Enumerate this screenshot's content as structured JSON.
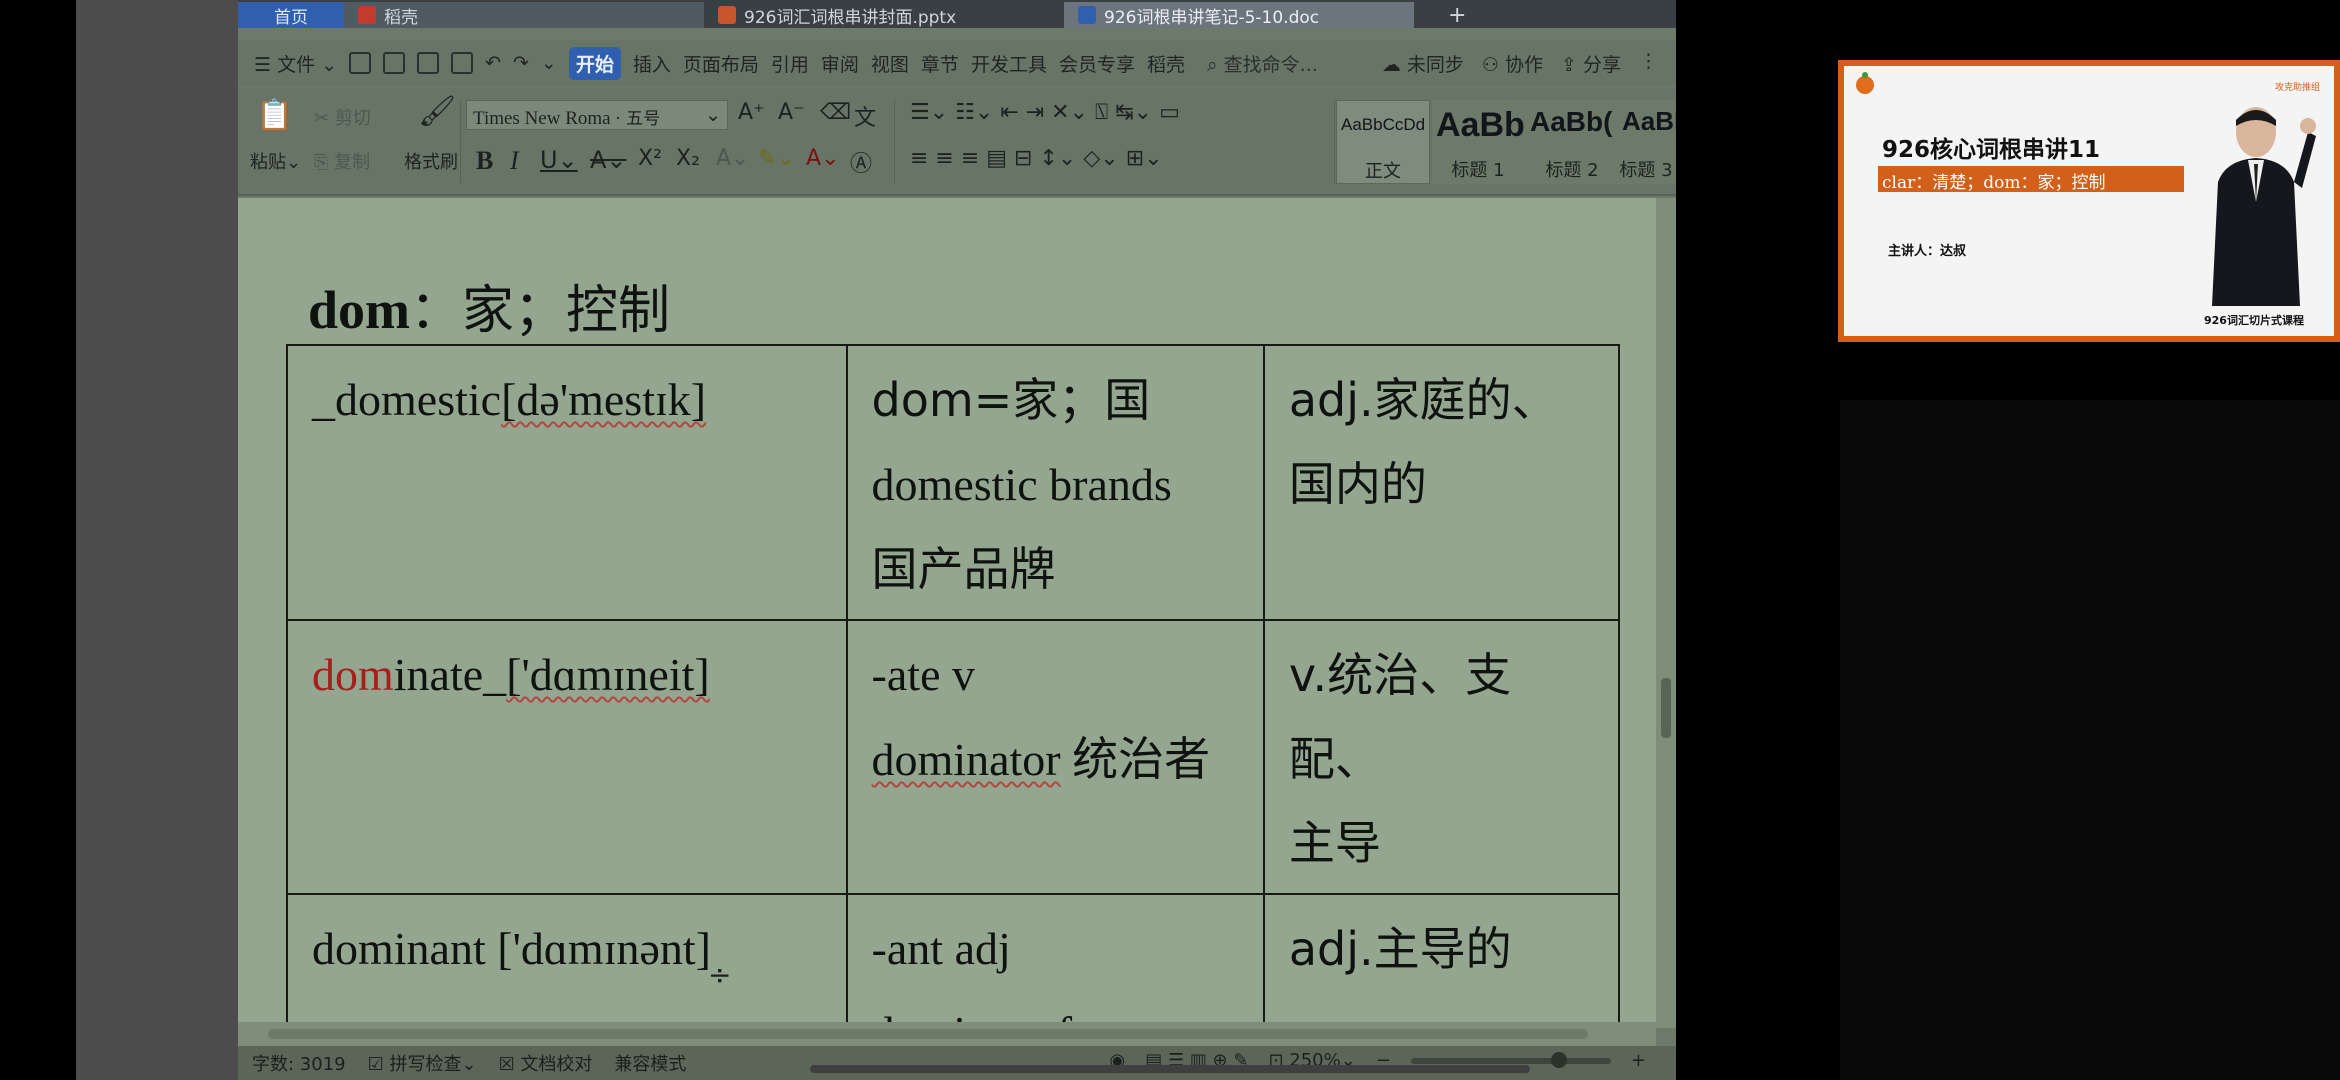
{
  "tabs": {
    "home": "首页",
    "daoke": "稻壳",
    "ppt": "926词汇词根串讲封面.pptx",
    "doc": "926词根串讲笔记-5-10.doc"
  },
  "menu": {
    "file": "文件",
    "start": "开始",
    "insert": "插入",
    "layout": "页面布局",
    "reference": "引用",
    "review": "审阅",
    "view": "视图",
    "chapter": "章节",
    "devtools": "开发工具",
    "vip": "会员专享",
    "daoke": "稻壳",
    "search_placeholder": "查找命令...",
    "unsynced": "未同步",
    "collab": "协作",
    "share": "分享"
  },
  "ribbon": {
    "paste": "粘贴",
    "cut": "剪切",
    "copy": "复制",
    "format_painter": "格式刷",
    "font_name": "Times New Roma",
    "font_size": "五号",
    "styles": [
      {
        "preview": "AaBbCcDd",
        "label": "正文"
      },
      {
        "preview": "AaBb",
        "label": "标题 1"
      },
      {
        "preview": "AaBb(",
        "label": "标题 2"
      },
      {
        "preview": "AaBbC",
        "label": "标题 3"
      }
    ]
  },
  "document": {
    "heading_en": "dom",
    "heading_cn": "：家；控制",
    "rows": [
      {
        "word_prefix": "",
        "word": "_domestic",
        "phonetic": "[də'mestɪk]",
        "root_line1": "dom=家；国",
        "root_line2": "domestic brands",
        "root_line3": "国产品牌",
        "meaning_line1": "adj.家庭的、",
        "meaning_line2": "国内的"
      },
      {
        "word_prefix": "dom",
        "word": "inate_",
        "phonetic": "['dɑmɪneit]",
        "root_line1": "-ate v",
        "root_line2": "dominator",
        "root_line2b": "统治者",
        "meaning_line1": "v.统治、支配、",
        "meaning_line2": "主导"
      },
      {
        "word_prefix": "",
        "word": "dominant",
        "phonetic": "['dɑmɪnənt]",
        "root_line1": "-ant adj",
        "root_line2": "dominant factor",
        "meaning_line1": "adj.主导的"
      }
    ]
  },
  "status": {
    "wordcount": "字数: 3019",
    "spellcheck": "拼写检查",
    "proofread": "文档校对",
    "compat": "兼容模式",
    "zoom": "250%"
  },
  "card": {
    "title": "926核心词根串讲11",
    "subtitle": "clar：清楚；dom：家；控制",
    "speaker": "主讲人：达叔",
    "footer": "926词汇切片式课程",
    "corner": "攻克助推组"
  },
  "colors": {
    "accent_orange": "#d2601a",
    "wps_blue": "#2f5fae",
    "root_red": "#a61e1e"
  }
}
